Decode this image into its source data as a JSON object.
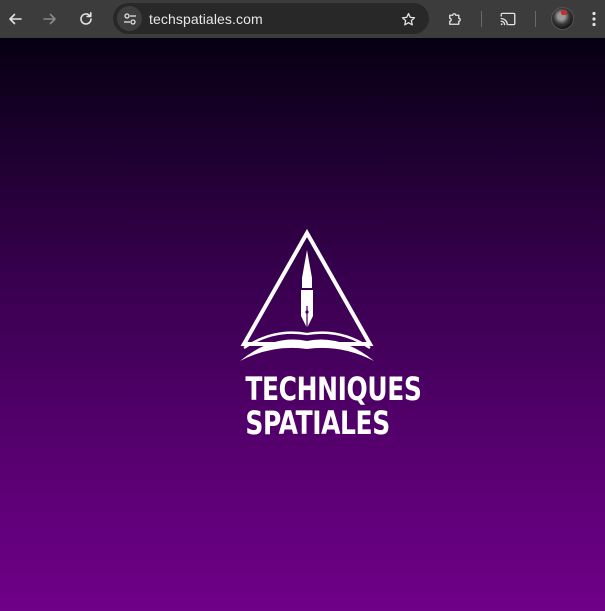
{
  "browser": {
    "url": "techspatiales.com",
    "icons": {
      "back": "arrow-left-icon",
      "forward": "arrow-right-icon",
      "reload": "reload-icon",
      "site_info": "tune-icon",
      "bookmark": "star-icon",
      "extensions": "puzzle-icon",
      "cast": "cast-icon",
      "menu": "more-vertical-icon"
    },
    "colors": {
      "toolbar": "#3c3c3c",
      "omnibox": "#282828"
    }
  },
  "page": {
    "logo_line1": "TECHNIQUES",
    "logo_line2": "SPATIALES",
    "colors": {
      "gradient_top": "#060012",
      "gradient_bottom": "#6f0088",
      "logo": "#ffffff"
    }
  }
}
